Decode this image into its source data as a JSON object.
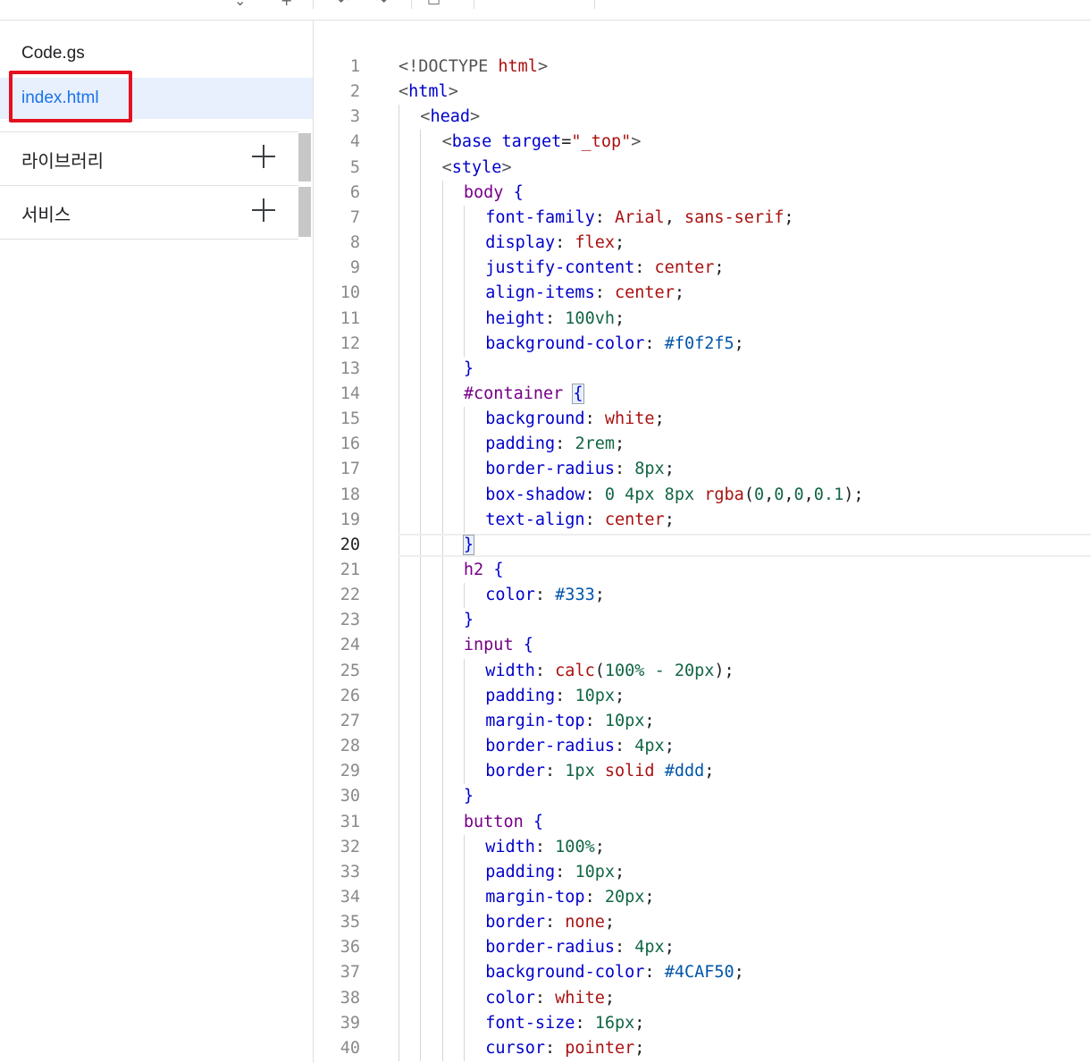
{
  "files": [
    {
      "name": "Code.gs",
      "active": false
    },
    {
      "name": "index.html",
      "active": true
    }
  ],
  "sections": [
    {
      "label": "라이브러리"
    },
    {
      "label": "서비스"
    }
  ],
  "editor": {
    "current_line": 20,
    "lines": [
      {
        "n": "1",
        "tokens": [
          [
            "dt",
            "<!DOCTYPE "
          ],
          [
            "val",
            "html"
          ],
          [
            "dt",
            ">"
          ]
        ],
        "indent": 0
      },
      {
        "n": "2",
        "tokens": [
          [
            "br",
            "<"
          ],
          [
            "prop",
            "html"
          ],
          [
            "br",
            ">"
          ]
        ],
        "indent": 0
      },
      {
        "n": "3",
        "tokens": [
          [
            "br",
            "<"
          ],
          [
            "prop",
            "head"
          ],
          [
            "br",
            ">"
          ]
        ],
        "indent": 1
      },
      {
        "n": "4",
        "tokens": [
          [
            "br",
            "<"
          ],
          [
            "prop",
            "base"
          ],
          [
            "pun",
            " "
          ],
          [
            "prop",
            "target"
          ],
          [
            "pun",
            "="
          ],
          [
            "val",
            "\"_top\""
          ],
          [
            "br",
            ">"
          ]
        ],
        "indent": 2
      },
      {
        "n": "5",
        "tokens": [
          [
            "br",
            "<"
          ],
          [
            "prop",
            "style"
          ],
          [
            "br",
            ">"
          ]
        ],
        "indent": 2
      },
      {
        "n": "6",
        "tokens": [
          [
            "kw",
            "body"
          ],
          [
            "pun",
            " "
          ],
          [
            "bracket",
            "{"
          ]
        ],
        "indent": 3
      },
      {
        "n": "7",
        "tokens": [
          [
            "prop",
            "font-family"
          ],
          [
            "pun",
            ": "
          ],
          [
            "val",
            "Arial"
          ],
          [
            "pun",
            ", "
          ],
          [
            "val",
            "sans-serif"
          ],
          [
            "pun",
            ";"
          ]
        ],
        "indent": 4
      },
      {
        "n": "8",
        "tokens": [
          [
            "prop",
            "display"
          ],
          [
            "pun",
            ": "
          ],
          [
            "val",
            "flex"
          ],
          [
            "pun",
            ";"
          ]
        ],
        "indent": 4
      },
      {
        "n": "9",
        "tokens": [
          [
            "prop",
            "justify-content"
          ],
          [
            "pun",
            ": "
          ],
          [
            "val",
            "center"
          ],
          [
            "pun",
            ";"
          ]
        ],
        "indent": 4
      },
      {
        "n": "10",
        "tokens": [
          [
            "prop",
            "align-items"
          ],
          [
            "pun",
            ": "
          ],
          [
            "val",
            "center"
          ],
          [
            "pun",
            ";"
          ]
        ],
        "indent": 4
      },
      {
        "n": "11",
        "tokens": [
          [
            "prop",
            "height"
          ],
          [
            "pun",
            ": "
          ],
          [
            "num",
            "100vh"
          ],
          [
            "pun",
            ";"
          ]
        ],
        "indent": 4
      },
      {
        "n": "12",
        "tokens": [
          [
            "prop",
            "background-color"
          ],
          [
            "pun",
            ": "
          ],
          [
            "hex",
            "#f0f2f5"
          ],
          [
            "pun",
            ";"
          ]
        ],
        "indent": 4
      },
      {
        "n": "13",
        "tokens": [
          [
            "bracket",
            "}"
          ]
        ],
        "indent": 3
      },
      {
        "n": "14",
        "tokens": [
          [
            "kw",
            "#container"
          ],
          [
            "pun",
            " "
          ],
          [
            "match",
            "{"
          ]
        ],
        "indent": 3
      },
      {
        "n": "15",
        "tokens": [
          [
            "prop",
            "background"
          ],
          [
            "pun",
            ": "
          ],
          [
            "val",
            "white"
          ],
          [
            "pun",
            ";"
          ]
        ],
        "indent": 4
      },
      {
        "n": "16",
        "tokens": [
          [
            "prop",
            "padding"
          ],
          [
            "pun",
            ": "
          ],
          [
            "num",
            "2rem"
          ],
          [
            "pun",
            ";"
          ]
        ],
        "indent": 4
      },
      {
        "n": "17",
        "tokens": [
          [
            "prop",
            "border-radius"
          ],
          [
            "pun",
            ": "
          ],
          [
            "num",
            "8px"
          ],
          [
            "pun",
            ";"
          ]
        ],
        "indent": 4
      },
      {
        "n": "18",
        "tokens": [
          [
            "prop",
            "box-shadow"
          ],
          [
            "pun",
            ": "
          ],
          [
            "num",
            "0 4px 8px "
          ],
          [
            "val",
            "rgba"
          ],
          [
            "pun",
            "("
          ],
          [
            "num",
            "0"
          ],
          [
            "pun",
            ","
          ],
          [
            "num",
            "0"
          ],
          [
            "pun",
            ","
          ],
          [
            "num",
            "0"
          ],
          [
            "pun",
            ","
          ],
          [
            "num",
            "0.1"
          ],
          [
            "pun",
            ");"
          ]
        ],
        "indent": 4
      },
      {
        "n": "19",
        "tokens": [
          [
            "prop",
            "text-align"
          ],
          [
            "pun",
            ": "
          ],
          [
            "val",
            "center"
          ],
          [
            "pun",
            ";"
          ]
        ],
        "indent": 4
      },
      {
        "n": "20",
        "tokens": [
          [
            "match",
            "}"
          ]
        ],
        "indent": 3
      },
      {
        "n": "21",
        "tokens": [
          [
            "kw",
            "h2"
          ],
          [
            "pun",
            " "
          ],
          [
            "bracket",
            "{"
          ]
        ],
        "indent": 3
      },
      {
        "n": "22",
        "tokens": [
          [
            "prop",
            "color"
          ],
          [
            "pun",
            ": "
          ],
          [
            "hex",
            "#333"
          ],
          [
            "pun",
            ";"
          ]
        ],
        "indent": 4
      },
      {
        "n": "23",
        "tokens": [
          [
            "bracket",
            "}"
          ]
        ],
        "indent": 3
      },
      {
        "n": "24",
        "tokens": [
          [
            "kw",
            "input"
          ],
          [
            "pun",
            " "
          ],
          [
            "bracket",
            "{"
          ]
        ],
        "indent": 3
      },
      {
        "n": "25",
        "tokens": [
          [
            "prop",
            "width"
          ],
          [
            "pun",
            ": "
          ],
          [
            "val",
            "calc"
          ],
          [
            "pun",
            "("
          ],
          [
            "num",
            "100% - 20px"
          ],
          [
            "pun",
            ");"
          ]
        ],
        "indent": 4
      },
      {
        "n": "26",
        "tokens": [
          [
            "prop",
            "padding"
          ],
          [
            "pun",
            ": "
          ],
          [
            "num",
            "10px"
          ],
          [
            "pun",
            ";"
          ]
        ],
        "indent": 4
      },
      {
        "n": "27",
        "tokens": [
          [
            "prop",
            "margin-top"
          ],
          [
            "pun",
            ": "
          ],
          [
            "num",
            "10px"
          ],
          [
            "pun",
            ";"
          ]
        ],
        "indent": 4
      },
      {
        "n": "28",
        "tokens": [
          [
            "prop",
            "border-radius"
          ],
          [
            "pun",
            ": "
          ],
          [
            "num",
            "4px"
          ],
          [
            "pun",
            ";"
          ]
        ],
        "indent": 4
      },
      {
        "n": "29",
        "tokens": [
          [
            "prop",
            "border"
          ],
          [
            "pun",
            ": "
          ],
          [
            "num",
            "1px "
          ],
          [
            "val",
            "solid"
          ],
          [
            "pun",
            " "
          ],
          [
            "hex",
            "#ddd"
          ],
          [
            "pun",
            ";"
          ]
        ],
        "indent": 4
      },
      {
        "n": "30",
        "tokens": [
          [
            "bracket",
            "}"
          ]
        ],
        "indent": 3
      },
      {
        "n": "31",
        "tokens": [
          [
            "kw",
            "button"
          ],
          [
            "pun",
            " "
          ],
          [
            "bracket",
            "{"
          ]
        ],
        "indent": 3
      },
      {
        "n": "32",
        "tokens": [
          [
            "prop",
            "width"
          ],
          [
            "pun",
            ": "
          ],
          [
            "num",
            "100%"
          ],
          [
            "pun",
            ";"
          ]
        ],
        "indent": 4
      },
      {
        "n": "33",
        "tokens": [
          [
            "prop",
            "padding"
          ],
          [
            "pun",
            ": "
          ],
          [
            "num",
            "10px"
          ],
          [
            "pun",
            ";"
          ]
        ],
        "indent": 4
      },
      {
        "n": "34",
        "tokens": [
          [
            "prop",
            "margin-top"
          ],
          [
            "pun",
            ": "
          ],
          [
            "num",
            "20px"
          ],
          [
            "pun",
            ";"
          ]
        ],
        "indent": 4
      },
      {
        "n": "35",
        "tokens": [
          [
            "prop",
            "border"
          ],
          [
            "pun",
            ": "
          ],
          [
            "val",
            "none"
          ],
          [
            "pun",
            ";"
          ]
        ],
        "indent": 4
      },
      {
        "n": "36",
        "tokens": [
          [
            "prop",
            "border-radius"
          ],
          [
            "pun",
            ": "
          ],
          [
            "num",
            "4px"
          ],
          [
            "pun",
            ";"
          ]
        ],
        "indent": 4
      },
      {
        "n": "37",
        "tokens": [
          [
            "prop",
            "background-color"
          ],
          [
            "pun",
            ": "
          ],
          [
            "hex",
            "#4CAF50"
          ],
          [
            "pun",
            ";"
          ]
        ],
        "indent": 4
      },
      {
        "n": "38",
        "tokens": [
          [
            "prop",
            "color"
          ],
          [
            "pun",
            ": "
          ],
          [
            "val",
            "white"
          ],
          [
            "pun",
            ";"
          ]
        ],
        "indent": 4
      },
      {
        "n": "39",
        "tokens": [
          [
            "prop",
            "font-size"
          ],
          [
            "pun",
            ": "
          ],
          [
            "num",
            "16px"
          ],
          [
            "pun",
            ";"
          ]
        ],
        "indent": 4
      },
      {
        "n": "40",
        "tokens": [
          [
            "prop",
            "cursor"
          ],
          [
            "pun",
            ": "
          ],
          [
            "val",
            "pointer"
          ],
          [
            "pun",
            ";"
          ]
        ],
        "indent": 4
      }
    ]
  },
  "colors": {
    "active_bg": "#e8f0fe",
    "active_text": "#1a73e8",
    "highlight_border": "#e5101f"
  }
}
